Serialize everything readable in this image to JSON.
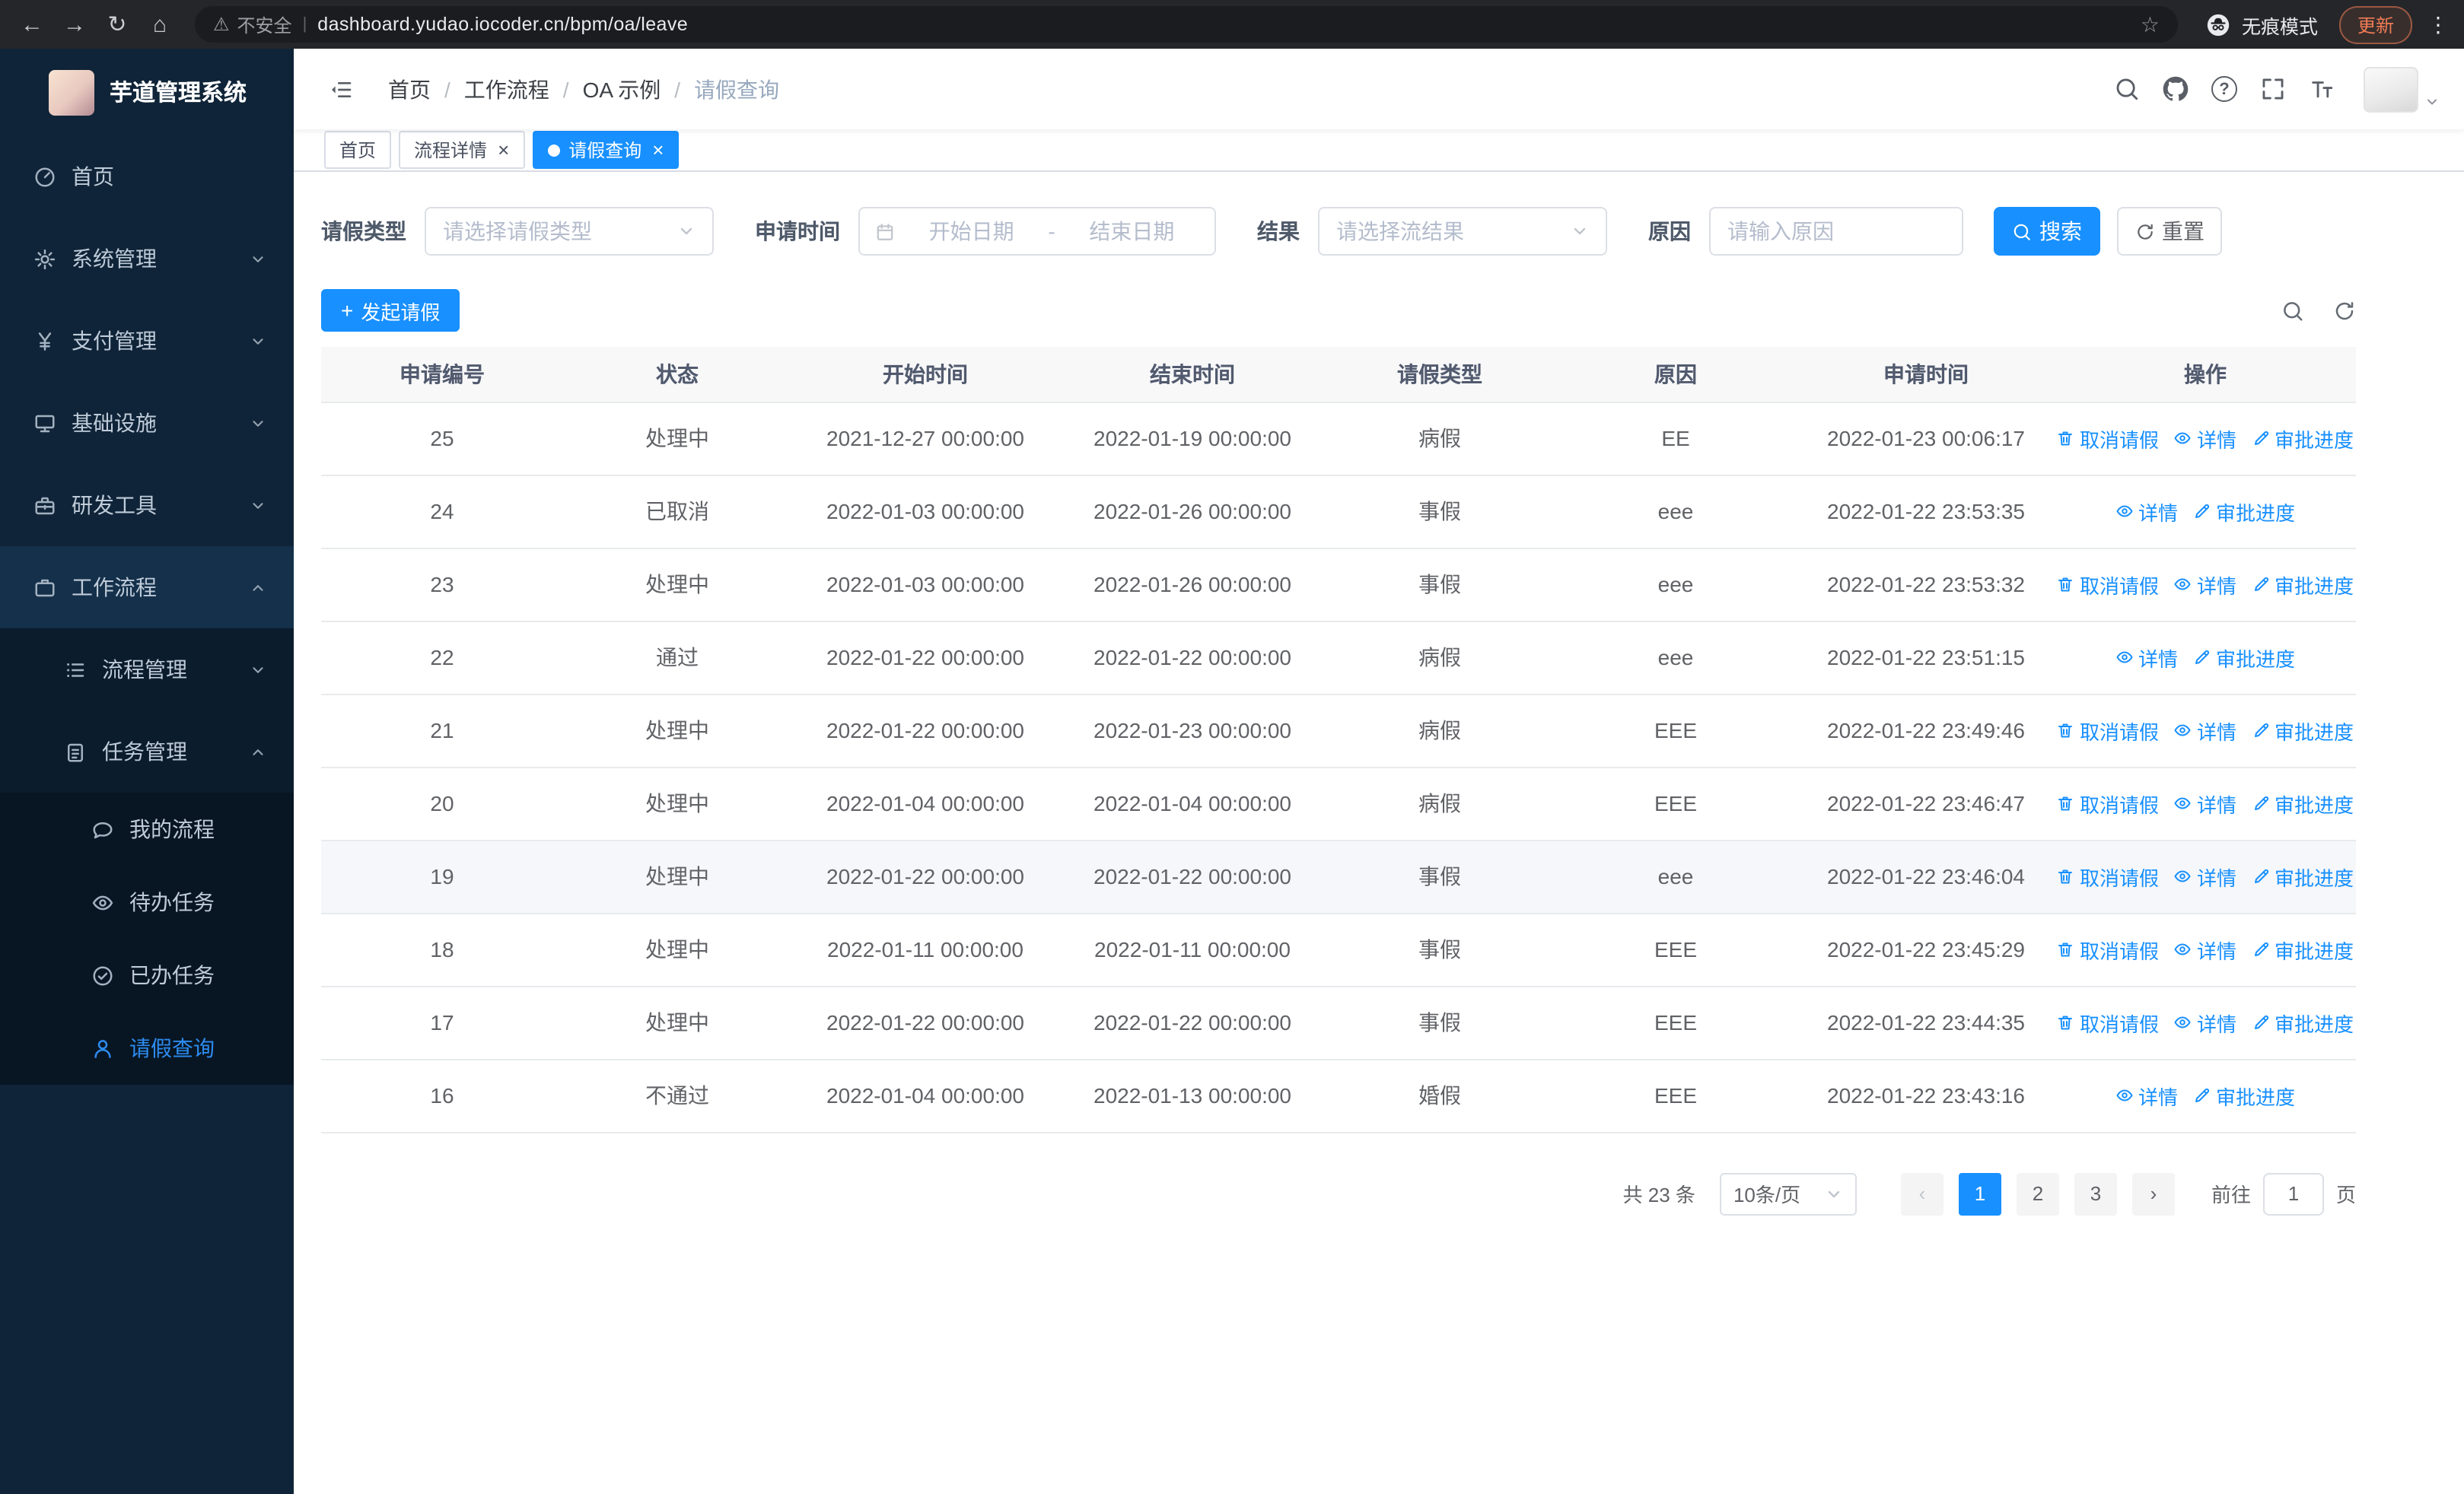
{
  "colors": {
    "primary": "#1890ff",
    "sidebar_bg": "#0f2438",
    "sidebar_sub_bg": "#0b1c2c",
    "sidebar_leaf_bg": "#081624",
    "sidebar_highlight_bg": "#14304a",
    "sidebar_text": "#bfcbd9",
    "sidebar_active_text": "#2d8cf0",
    "chrome_bg": "#242629",
    "omnibox_bg": "#1b1c1f",
    "update_accent": "#f07b54"
  },
  "glyphs": {
    "back": "←",
    "forward": "→",
    "reload": "↻",
    "home": "⌂",
    "warning": "⚠",
    "star": "☆",
    "menu_dots": "⋮",
    "question": "?",
    "close": "×",
    "prev": "‹",
    "next": "›",
    "plus": "+",
    "breadcrumb_separator": "/",
    "date_separator": "-"
  },
  "browser": {
    "warning_text": "不安全",
    "url": "dashboard.yudao.iocoder.cn/bpm/oa/leave",
    "incognito_text": "无痕模式",
    "update_text": "更新"
  },
  "sidebar": {
    "logo_title": "芋道管理系统",
    "menu": [
      {
        "key": "home",
        "label": "首页",
        "icon": "dashboard-icon",
        "level": 1
      },
      {
        "key": "system",
        "label": "系统管理",
        "icon": "gear-icon",
        "level": 1,
        "chevron": "down"
      },
      {
        "key": "payment",
        "label": "支付管理",
        "icon": "yen-icon",
        "level": 1,
        "chevron": "down"
      },
      {
        "key": "infrastructure",
        "label": "基础设施",
        "icon": "monitor-icon",
        "level": 1,
        "chevron": "down"
      },
      {
        "key": "devtools",
        "label": "研发工具",
        "icon": "tools-icon",
        "level": 1,
        "chevron": "down"
      },
      {
        "key": "workflow",
        "label": "工作流程",
        "icon": "briefcase-icon",
        "level": 1,
        "chevron": "up",
        "highlighted": true
      },
      {
        "key": "process-management",
        "label": "流程管理",
        "icon": "list-icon",
        "level": 2,
        "chevron": "down"
      },
      {
        "key": "task-management",
        "label": "任务管理",
        "icon": "clipboard-icon",
        "level": 2,
        "chevron": "up"
      },
      {
        "key": "my-process",
        "label": "我的流程",
        "icon": "chat-icon",
        "level": 3
      },
      {
        "key": "todo-tasks",
        "label": "待办任务",
        "icon": "eye-icon",
        "level": 3
      },
      {
        "key": "done-tasks",
        "label": "已办任务",
        "icon": "check-icon",
        "level": 3
      },
      {
        "key": "leave-query",
        "label": "请假查询",
        "icon": "user-icon",
        "level": 3,
        "active": true
      }
    ]
  },
  "breadcrumb": [
    "首页",
    "工作流程",
    "OA 示例",
    "请假查询"
  ],
  "tabs": [
    {
      "key": "home",
      "label": "首页",
      "closable": false,
      "active": false,
      "dot": false
    },
    {
      "key": "process-detail",
      "label": "流程详情",
      "closable": true,
      "active": false,
      "dot": false
    },
    {
      "key": "leave-query",
      "label": "请假查询",
      "closable": true,
      "active": true,
      "dot": true
    }
  ],
  "filters": {
    "leave_type_label": "请假类型",
    "leave_type_placeholder": "请选择请假类型",
    "apply_time_label": "申请时间",
    "start_date_placeholder": "开始日期",
    "end_date_placeholder": "结束日期",
    "result_label": "结果",
    "result_placeholder": "请选择流结果",
    "reason_label": "原因",
    "reason_placeholder": "请输入原因",
    "search_button": "搜索",
    "reset_button": "重置"
  },
  "toolbar": {
    "create_button": "发起请假"
  },
  "table": {
    "columns": [
      "申请编号",
      "状态",
      "开始时间",
      "结束时间",
      "请假类型",
      "原因",
      "申请时间",
      "操作"
    ],
    "rows": [
      {
        "id": "25",
        "status": "处理中",
        "start_time": "2021-12-27 00:00:00",
        "end_time": "2022-01-19 00:00:00",
        "leave_type": "病假",
        "reason": "EE",
        "apply_time": "2022-01-23 00:06:17",
        "actions": [
          {
            "type": "cancel",
            "label": "取消请假"
          },
          {
            "type": "detail",
            "label": "详情"
          },
          {
            "type": "progress",
            "label": "审批进度"
          }
        ]
      },
      {
        "id": "24",
        "status": "已取消",
        "start_time": "2022-01-03 00:00:00",
        "end_time": "2022-01-26 00:00:00",
        "leave_type": "事假",
        "reason": "eee",
        "apply_time": "2022-01-22 23:53:35",
        "actions": [
          {
            "type": "detail",
            "label": "详情"
          },
          {
            "type": "progress",
            "label": "审批进度"
          }
        ]
      },
      {
        "id": "23",
        "status": "处理中",
        "start_time": "2022-01-03 00:00:00",
        "end_time": "2022-01-26 00:00:00",
        "leave_type": "事假",
        "reason": "eee",
        "apply_time": "2022-01-22 23:53:32",
        "actions": [
          {
            "type": "cancel",
            "label": "取消请假"
          },
          {
            "type": "detail",
            "label": "详情"
          },
          {
            "type": "progress",
            "label": "审批进度"
          }
        ]
      },
      {
        "id": "22",
        "status": "通过",
        "start_time": "2022-01-22 00:00:00",
        "end_time": "2022-01-22 00:00:00",
        "leave_type": "病假",
        "reason": "eee",
        "apply_time": "2022-01-22 23:51:15",
        "actions": [
          {
            "type": "detail",
            "label": "详情"
          },
          {
            "type": "progress",
            "label": "审批进度"
          }
        ]
      },
      {
        "id": "21",
        "status": "处理中",
        "start_time": "2022-01-22 00:00:00",
        "end_time": "2022-01-23 00:00:00",
        "leave_type": "病假",
        "reason": "EEE",
        "apply_time": "2022-01-22 23:49:46",
        "actions": [
          {
            "type": "cancel",
            "label": "取消请假"
          },
          {
            "type": "detail",
            "label": "详情"
          },
          {
            "type": "progress",
            "label": "审批进度"
          }
        ]
      },
      {
        "id": "20",
        "status": "处理中",
        "start_time": "2022-01-04 00:00:00",
        "end_time": "2022-01-04 00:00:00",
        "leave_type": "病假",
        "reason": "EEE",
        "apply_time": "2022-01-22 23:46:47",
        "actions": [
          {
            "type": "cancel",
            "label": "取消请假"
          },
          {
            "type": "detail",
            "label": "详情"
          },
          {
            "type": "progress",
            "label": "审批进度"
          }
        ]
      },
      {
        "id": "19",
        "status": "处理中",
        "start_time": "2022-01-22 00:00:00",
        "end_time": "2022-01-22 00:00:00",
        "leave_type": "事假",
        "reason": "eee",
        "apply_time": "2022-01-22 23:46:04",
        "highlighted": true,
        "actions": [
          {
            "type": "cancel",
            "label": "取消请假"
          },
          {
            "type": "detail",
            "label": "详情"
          },
          {
            "type": "progress",
            "label": "审批进度"
          }
        ]
      },
      {
        "id": "18",
        "status": "处理中",
        "start_time": "2022-01-11 00:00:00",
        "end_time": "2022-01-11 00:00:00",
        "leave_type": "事假",
        "reason": "EEE",
        "apply_time": "2022-01-22 23:45:29",
        "actions": [
          {
            "type": "cancel",
            "label": "取消请假"
          },
          {
            "type": "detail",
            "label": "详情"
          },
          {
            "type": "progress",
            "label": "审批进度"
          }
        ]
      },
      {
        "id": "17",
        "status": "处理中",
        "start_time": "2022-01-22 00:00:00",
        "end_time": "2022-01-22 00:00:00",
        "leave_type": "事假",
        "reason": "EEE",
        "apply_time": "2022-01-22 23:44:35",
        "actions": [
          {
            "type": "cancel",
            "label": "取消请假"
          },
          {
            "type": "detail",
            "label": "详情"
          },
          {
            "type": "progress",
            "label": "审批进度"
          }
        ]
      },
      {
        "id": "16",
        "status": "不通过",
        "start_time": "2022-01-04 00:00:00",
        "end_time": "2022-01-13 00:00:00",
        "leave_type": "婚假",
        "reason": "EEE",
        "apply_time": "2022-01-22 23:43:16",
        "actions": [
          {
            "type": "detail",
            "label": "详情"
          },
          {
            "type": "progress",
            "label": "审批进度"
          }
        ]
      }
    ]
  },
  "pagination": {
    "total_text": "共 23 条",
    "page_size_text": "10条/页",
    "pages": [
      "1",
      "2",
      "3"
    ],
    "active_page": "1",
    "goto_label": "前往",
    "goto_value": "1",
    "page_unit": "页"
  }
}
